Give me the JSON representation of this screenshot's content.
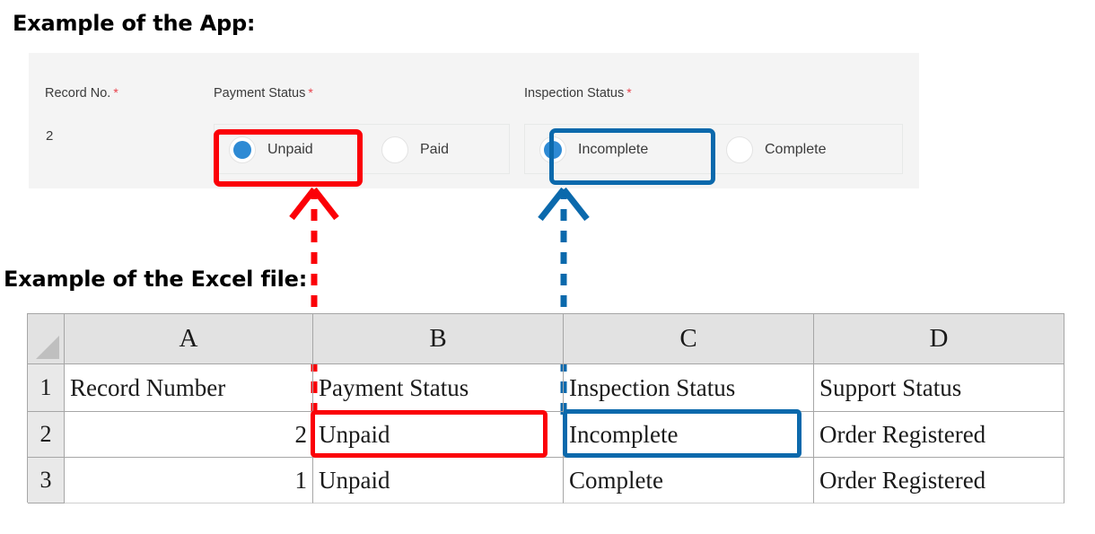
{
  "captions": {
    "app": "Example of the App:",
    "excel": "Example of the Excel file:"
  },
  "colors": {
    "accent_blue": "#2e8ad4",
    "highlight_red": "#fb0007",
    "highlight_blue": "#0b69ac",
    "required_star": "#e8404a",
    "panel_background": "#f4f4f4",
    "grid_header_background": "#e2e2e2"
  },
  "app": {
    "fields": [
      {
        "label": "Record No.",
        "required_marker": "*",
        "type": "value",
        "value": "2"
      },
      {
        "label": "Payment Status",
        "required_marker": "*",
        "type": "radio",
        "options": [
          {
            "label": "Unpaid",
            "checked": true
          },
          {
            "label": "Paid",
            "checked": false
          }
        ]
      },
      {
        "label": "Inspection Status",
        "required_marker": "*",
        "type": "radio",
        "options": [
          {
            "label": "Incomplete",
            "checked": true
          },
          {
            "label": "Complete",
            "checked": false
          }
        ]
      }
    ]
  },
  "excel": {
    "column_headers": [
      "A",
      "B",
      "C",
      "D"
    ],
    "row_headers": [
      "1",
      "2",
      "3"
    ],
    "rows": [
      {
        "number": "1",
        "cells": [
          "Record Number",
          "Payment Status",
          "Inspection Status",
          "Support Status"
        ]
      },
      {
        "number": "2",
        "cells": [
          "2",
          "Unpaid",
          "Incomplete",
          "Order Registered"
        ]
      },
      {
        "number": "3",
        "cells": [
          "1",
          "Unpaid",
          "Complete",
          "Order Registered"
        ]
      }
    ]
  },
  "annotations": {
    "red": {
      "source_label": "Unpaid",
      "app_target": "Payment Status radio Unpaid",
      "excel_target": "cell B2 Unpaid"
    },
    "blue": {
      "source_label": "Incomplete",
      "app_target": "Inspection Status radio Incomplete",
      "excel_target": "cell C2 Incomplete"
    }
  }
}
